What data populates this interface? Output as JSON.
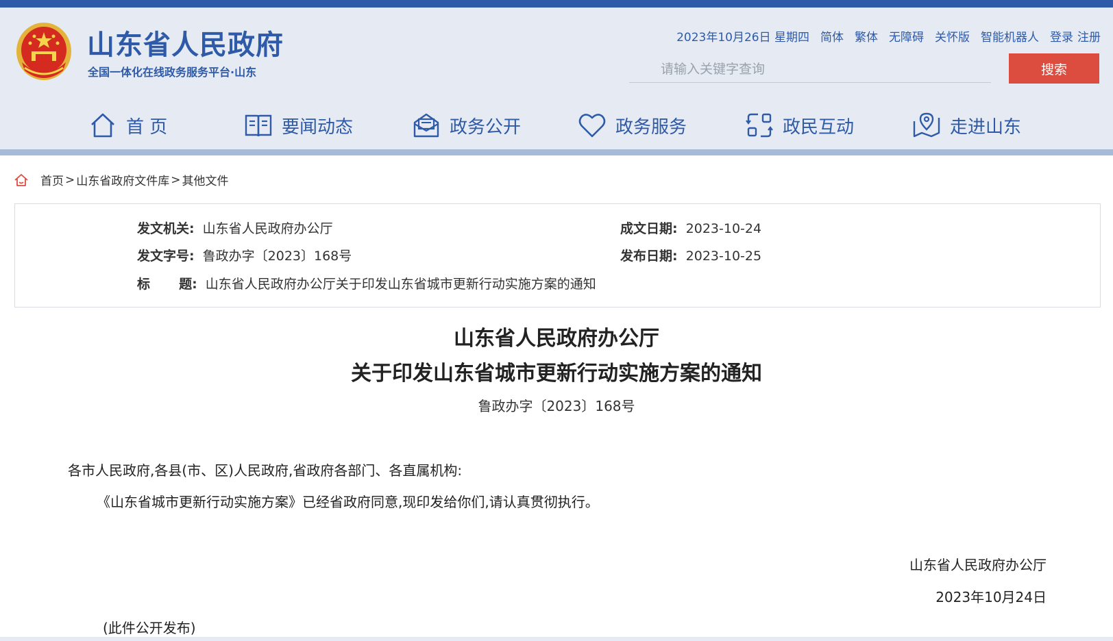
{
  "header": {
    "site_title": "山东省人民政府",
    "site_subtitle": "全国一体化在线政务服务平台·山东",
    "utility": {
      "date": "2023年10月26日 星期四",
      "simplified": "简体",
      "traditional": "繁体",
      "accessibility": "无障碍",
      "care": "关怀版",
      "robot": "智能机器人",
      "login": "登录",
      "register": "注册"
    },
    "search": {
      "placeholder": "请输入关键字查询",
      "button": "搜索"
    },
    "colors": {
      "brand": "#2e5aa7",
      "search_button": "#dc4c3f",
      "header_bg": "#e6ebf3"
    }
  },
  "nav": {
    "items": [
      {
        "label": "首 页",
        "icon": "home-icon"
      },
      {
        "label": "要闻动态",
        "icon": "book-icon"
      },
      {
        "label": "政务公开",
        "icon": "mail-icon"
      },
      {
        "label": "政务服务",
        "icon": "heart-icon"
      },
      {
        "label": "政民互动",
        "icon": "interaction-icon"
      },
      {
        "label": "走进山东",
        "icon": "map-pin-icon"
      }
    ]
  },
  "breadcrumb": {
    "home": "首页",
    "library": "山东省政府文件库",
    "current": "其他文件",
    "separator": ">"
  },
  "meta": {
    "issuer_label": "发文机关:",
    "issuer": "山东省人民政府办公厅",
    "docno_label": "发文字号:",
    "docno": "鲁政办字〔2023〕168号",
    "title_label_1": "标",
    "title_label_2": "题:",
    "title": "山东省人民政府办公厅关于印发山东省城市更新行动实施方案的通知",
    "written_label": "成文日期:",
    "written": "2023-10-24",
    "published_label": "发布日期:",
    "published": "2023-10-25"
  },
  "document": {
    "title_line1": "山东省人民政府办公厅",
    "title_line2": "关于印发山东省城市更新行动实施方案的通知",
    "number": "鲁政办字〔2023〕168号",
    "salutation": "各市人民政府,各县(市、区)人民政府,省政府各部门、各直属机构:",
    "body": "《山东省城市更新行动实施方案》已经省政府同意,现印发给你们,请认真贯彻执行。",
    "signature": "山东省人民政府办公厅",
    "date": "2023年10月24日",
    "note": "(此件公开发布)"
  }
}
